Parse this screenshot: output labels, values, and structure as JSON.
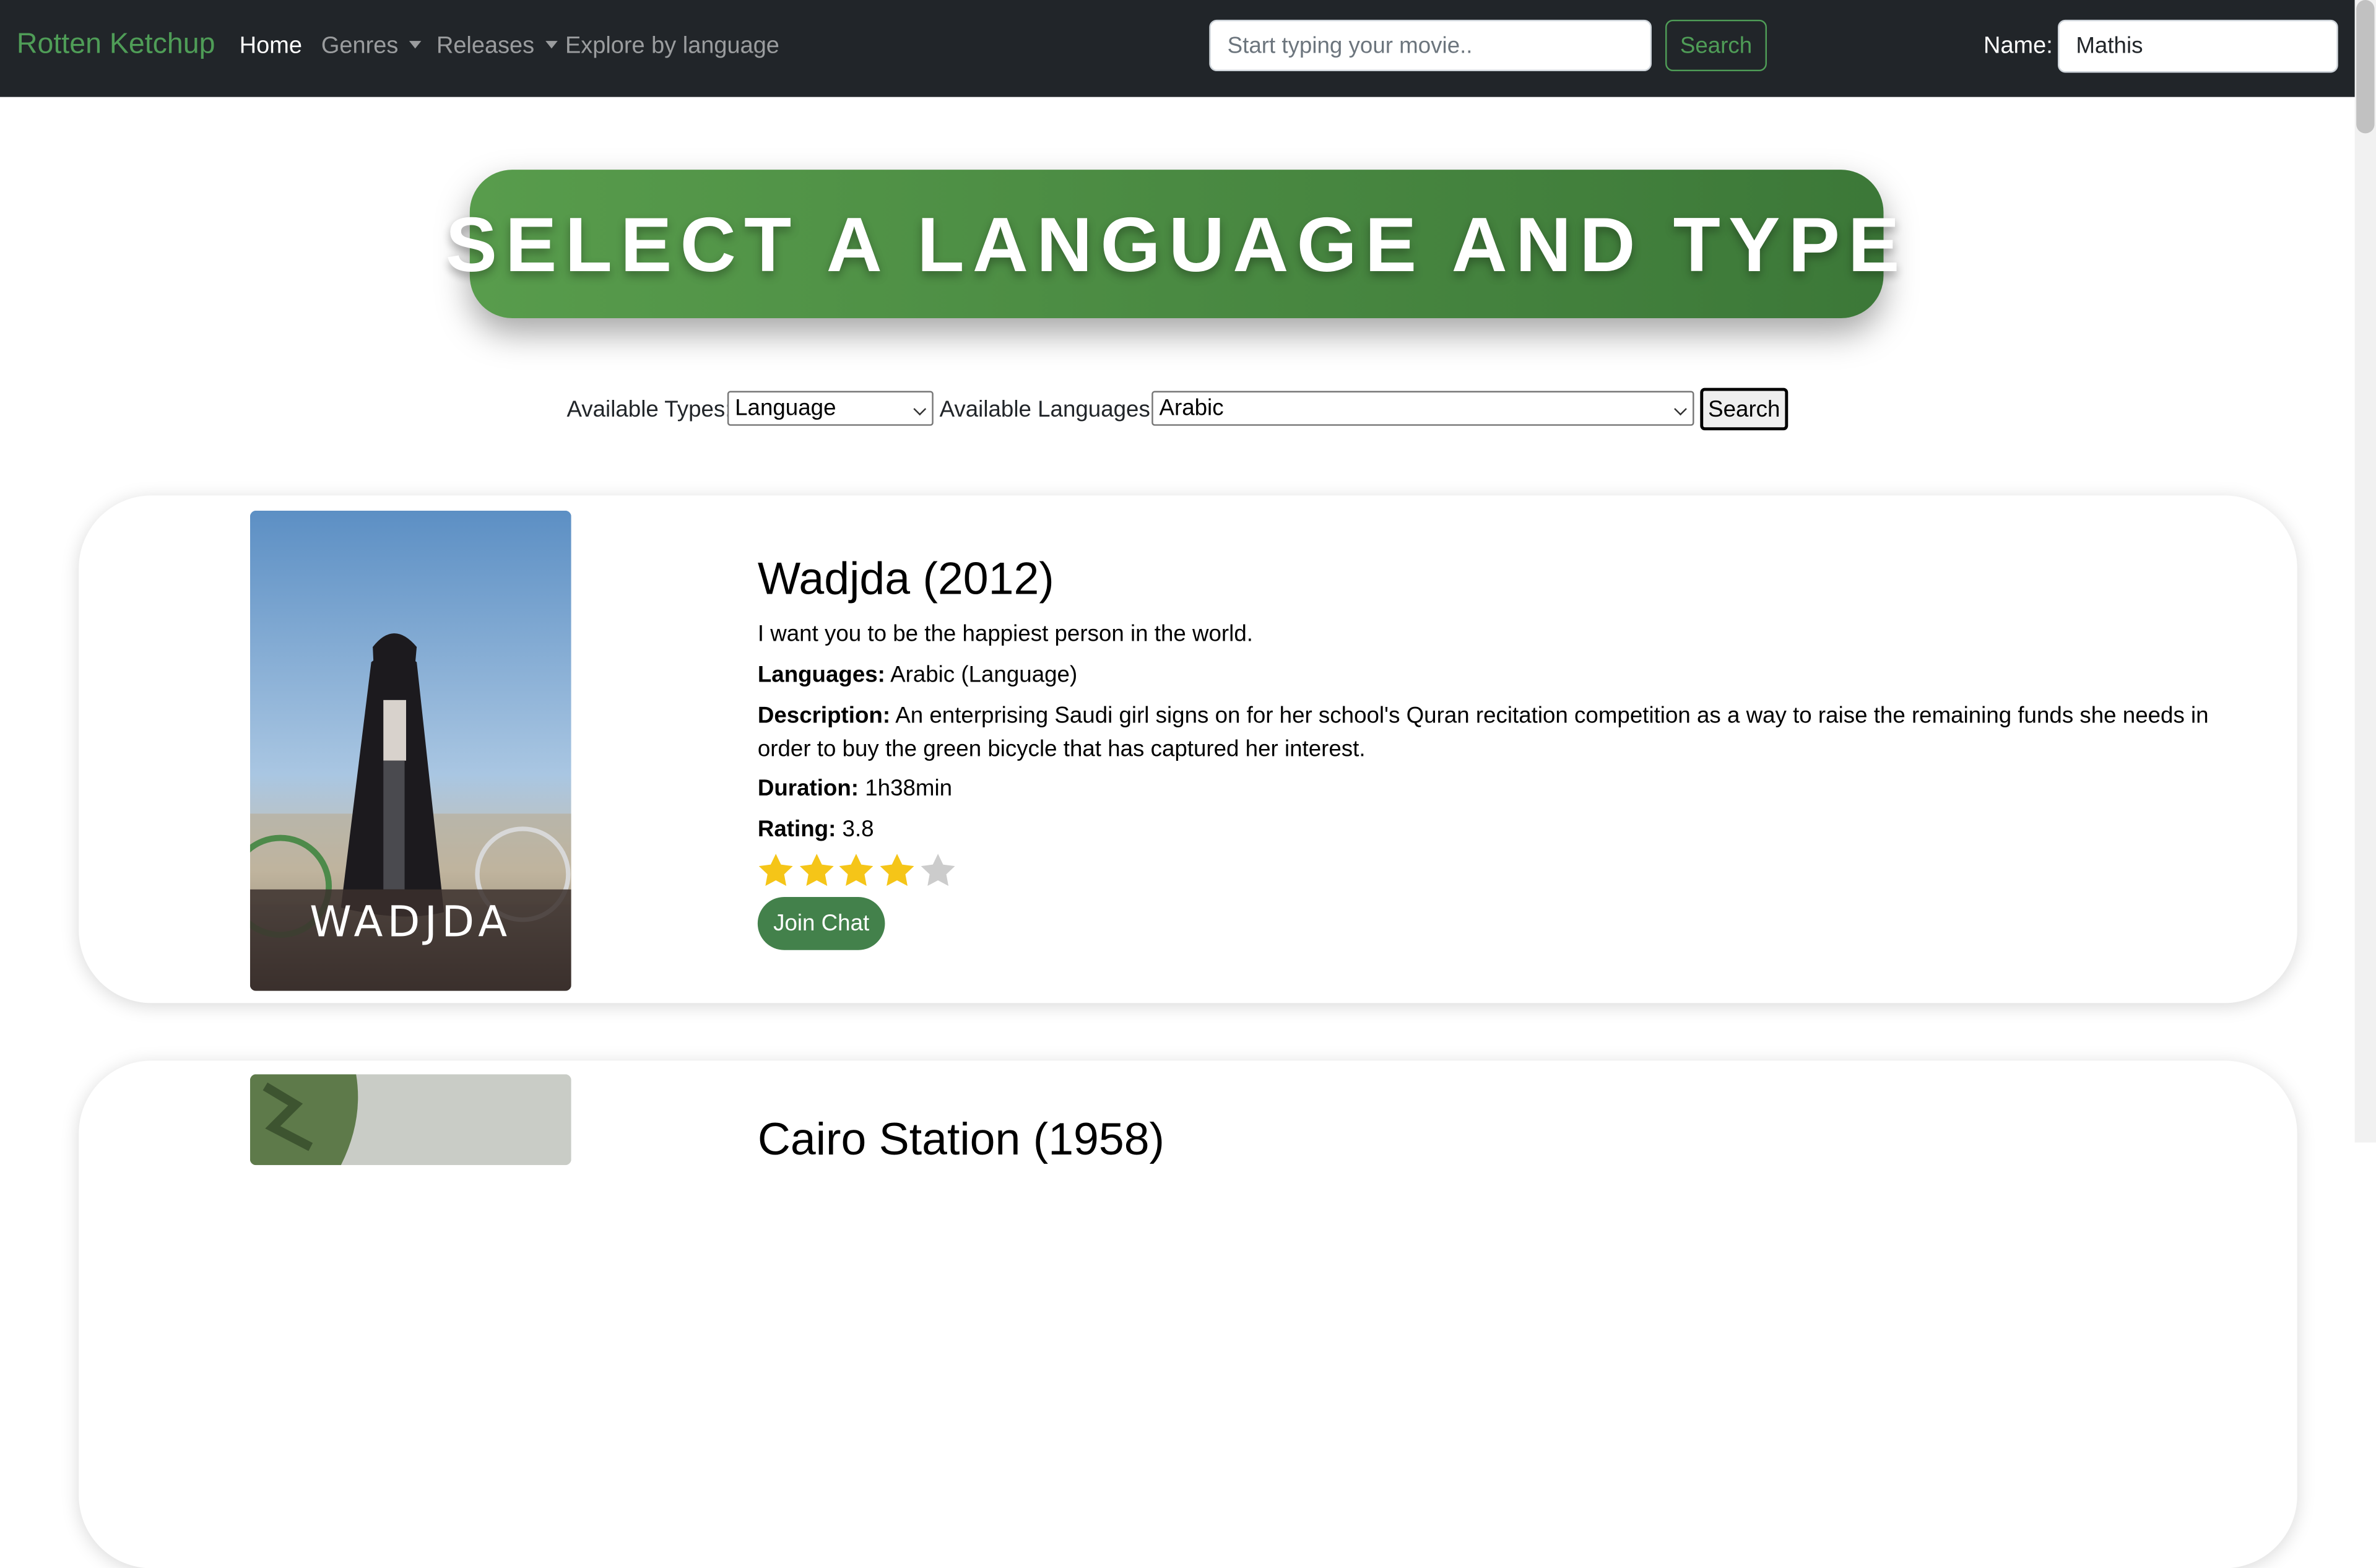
{
  "nav": {
    "brand": "Rotten Ketchup",
    "home": "Home",
    "genres": "Genres",
    "releases": "Releases",
    "explore": "Explore by language",
    "search_placeholder": "Start typing your movie..",
    "search_button": "Search",
    "name_label": "Name:",
    "name_value": "Mathis"
  },
  "banner": {
    "title": "SELECT A LANGUAGE AND TYPE"
  },
  "filters": {
    "types_label": "Available Types:",
    "types_selected": "Language",
    "languages_label": "Available Languages:",
    "languages_selected": "Arabic",
    "search_button": "Search"
  },
  "movies": [
    {
      "title": "Wadjda (2012)",
      "poster_text": "WADJDA",
      "tagline": "I want you to be the happiest person in the world.",
      "languages_label": "Languages:",
      "languages": "Arabic (Language)",
      "description_label": "Description:",
      "description": "An enterprising Saudi girl signs on for her school's Quran recitation competition as a way to raise the remaining funds she needs in order to buy the green bicycle that has captured her interest.",
      "duration_label": "Duration:",
      "duration": "1h38min",
      "rating_label": "Rating:",
      "rating": "3.8",
      "stars_filled": 4,
      "stars_total": 5,
      "chat_button": "Join Chat"
    },
    {
      "title": "Cairo Station (1958)"
    }
  ],
  "colors": {
    "navbar": "#212529",
    "brand": "#4f9d57",
    "banner": "#4a8c42",
    "star_filled": "#f5c518",
    "star_empty": "#cccccc",
    "chat_button": "#43814b"
  }
}
